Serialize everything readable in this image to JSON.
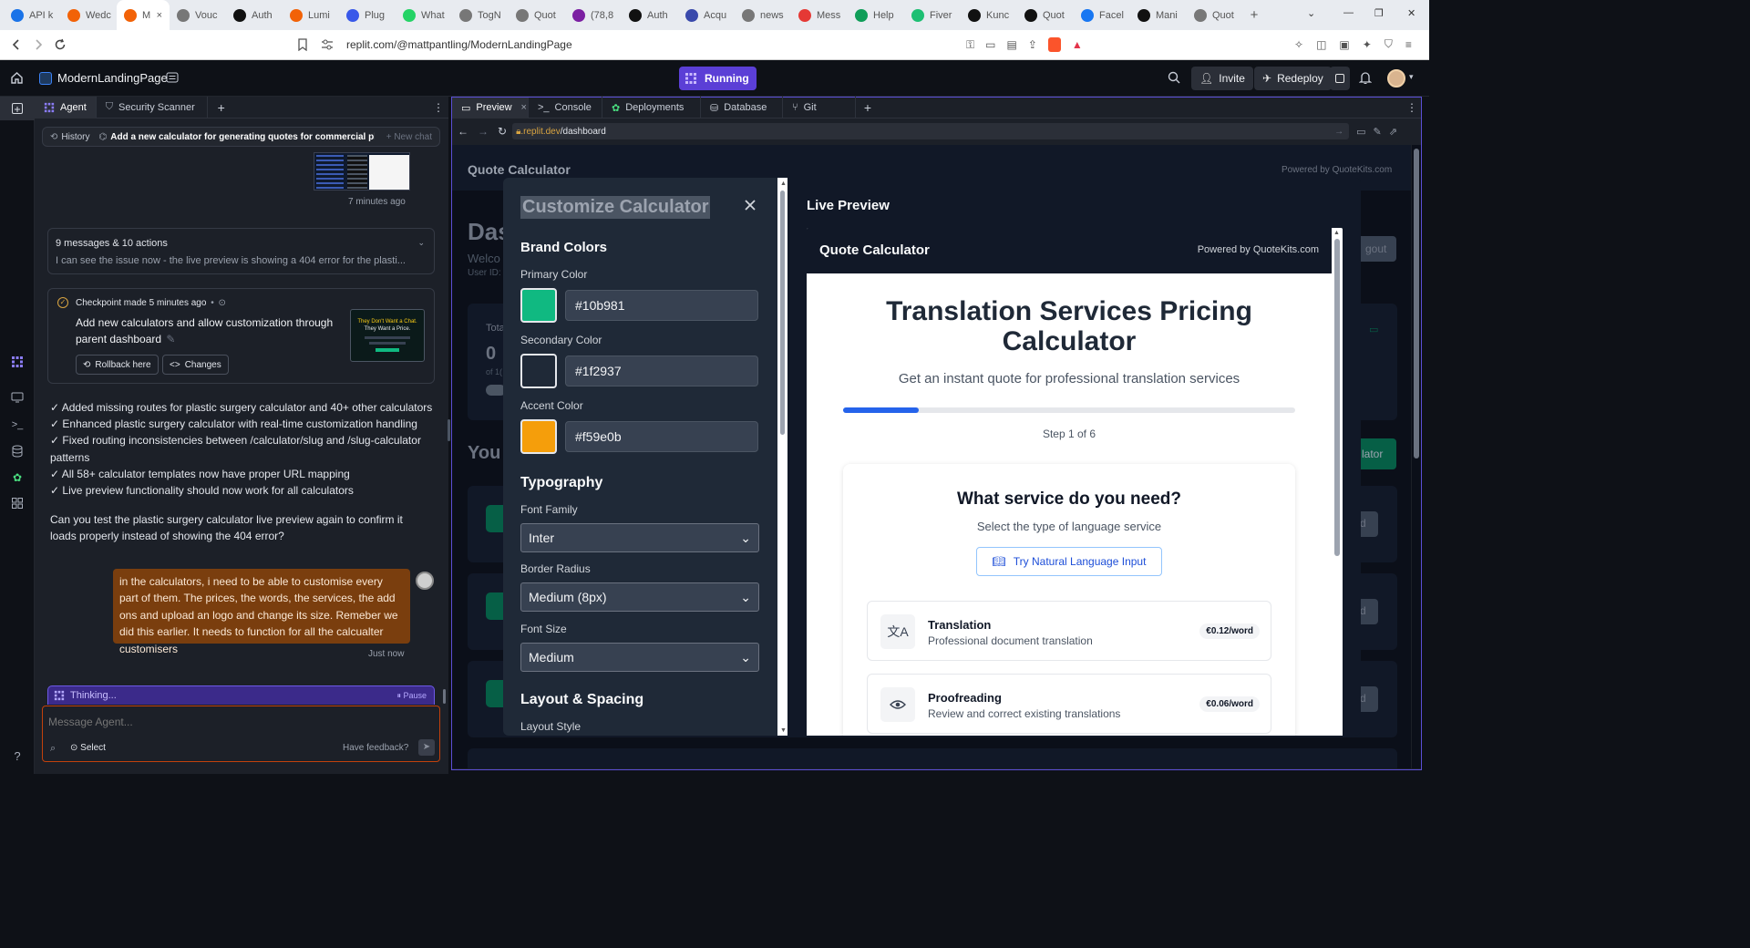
{
  "browser": {
    "tabs": [
      {
        "label": "API k",
        "icon_color": "#1a73e8"
      },
      {
        "label": "Wedc",
        "icon_color": "#f26207"
      },
      {
        "label": "M",
        "icon_color": "#f26207"
      },
      {
        "label": "Vouc",
        "icon_color": "#777777"
      },
      {
        "label": "Auth",
        "icon_color": "#111111"
      },
      {
        "label": "Lumi",
        "icon_color": "#f26207"
      },
      {
        "label": "Plug",
        "icon_color": "#3858e9"
      },
      {
        "label": "What",
        "icon_color": "#25d366"
      },
      {
        "label": "TogN",
        "icon_color": "#777777"
      },
      {
        "label": "Quot",
        "icon_color": "#777777"
      },
      {
        "label": "(78,8",
        "icon_color": "#7b1fa2"
      },
      {
        "label": "Auth",
        "icon_color": "#111111"
      },
      {
        "label": "Acqu",
        "icon_color": "#3949ab"
      },
      {
        "label": "news",
        "icon_color": "#777777"
      },
      {
        "label": "Mess",
        "icon_color": "#e53935"
      },
      {
        "label": "Help",
        "icon_color": "#0f9d58"
      },
      {
        "label": "Fiver",
        "icon_color": "#1dbf73"
      },
      {
        "label": "Kunc",
        "icon_color": "#111111"
      },
      {
        "label": "Quot",
        "icon_color": "#111111"
      },
      {
        "label": "Facel",
        "icon_color": "#1877f2"
      },
      {
        "label": "Mani",
        "icon_color": "#111111"
      },
      {
        "label": "Quot",
        "icon_color": "#777777"
      }
    ],
    "url": "replit.com/@mattpantling/ModernLandingPage"
  },
  "app": {
    "project_name": "ModernLandingPage",
    "run_status": "Running",
    "invite_label": "Invite",
    "redeploy_label": "Redeploy"
  },
  "agent": {
    "tabs": [
      "Agent",
      "Security Scanner"
    ],
    "history_label": "History",
    "chat_title": "Add a new calculator for generating quotes for commercial ph...",
    "new_chat_label": "New chat",
    "screenshot_time": "7 minutes ago",
    "summary_count": "9 messages & 10 actions",
    "summary_text": "I can see the issue now - the live preview is showing a 404 error for the plasti...",
    "checkpoint_label": "Checkpoint made 5 minutes ago",
    "checkpoint_dot": "•",
    "checkpoint_text": "Add new calculators and allow customization through parent dashboard",
    "checkpoint_thumb_line1": "They Don't Want a Chat.",
    "checkpoint_thumb_line2": "They Want a Price.",
    "rollback_label": "Rollback here",
    "changes_label": "Changes",
    "checklist": [
      "✓ Added missing routes for plastic surgery calculator and 40+ other calculators",
      "✓ Enhanced plastic surgery calculator with real-time customization handling",
      "✓ Fixed routing inconsistencies between /calculator/slug and /slug-calculator patterns",
      "✓ All 58+ calculator templates now have proper URL mapping",
      "✓ Live preview functionality should now work for all calculators"
    ],
    "question": "Can you test the plastic surgery calculator live preview again to confirm it loads properly instead of showing the 404 error?",
    "user_message": "in the calculators, i need to be able to customise every part of them. The prices, the words, the services, the add ons and upload an logo and change its size. Remeber we did this earlier. It needs to function for all the calcualter customisers",
    "user_time": "Just now",
    "thinking_label": "Thinking...",
    "pause_label": "Pause",
    "input_placeholder": "Message Agent...",
    "select_label": "Select",
    "feedback_label": "Have feedback?"
  },
  "preview": {
    "tabs": [
      "Preview",
      "Console",
      "Deployments",
      "Database",
      "Git"
    ],
    "url_host": ".replit.dev",
    "url_path": "/dashboard",
    "bg_title": "Quote Calculator",
    "bg_powered": "Powered by QuoteKits.com",
    "bg_heading": "Das",
    "bg_welcome": "Welco",
    "bg_userid": "User ID:",
    "bg_total": "Tota",
    "bg_zero": "0",
    "bg_of": "of 1(",
    "bg_your": "You",
    "bg_logout": "gout",
    "bg_create": "lator",
    "bg_row_btn": "d"
  },
  "customize": {
    "title": "Customize Calculator",
    "brand_colors": "Brand Colors",
    "colors": [
      {
        "label": "Primary Color",
        "value": "#10b981"
      },
      {
        "label": "Secondary Color",
        "value": "#1f2937"
      },
      {
        "label": "Accent Color",
        "value": "#f59e0b"
      }
    ],
    "typography": "Typography",
    "font_family_label": "Font Family",
    "font_family_value": "Inter",
    "border_radius_label": "Border Radius",
    "border_radius_value": "Medium (8px)",
    "font_size_label": "Font Size",
    "font_size_value": "Medium",
    "layout_spacing": "Layout & Spacing",
    "layout_style_label": "Layout Style"
  },
  "live": {
    "title": "Live Preview",
    "calc_header": "Quote Calculator",
    "calc_powered": "Powered by QuoteKits.com",
    "main_title": "Translation Services Pricing Calculator",
    "subtitle": "Get an instant quote for professional translation services",
    "progress": 0.167,
    "step_label": "Step 1 of 6",
    "question": "What service do you need?",
    "question_sub": "Select the type of language service",
    "nl_button": "Try Natural Language Input",
    "services": [
      {
        "name": "Translation",
        "desc": "Professional document translation",
        "price": "€0.12/word",
        "icon": "translate-icon"
      },
      {
        "name": "Proofreading",
        "desc": "Review and correct existing translations",
        "price": "€0.06/word",
        "icon": "eye-icon"
      }
    ]
  }
}
